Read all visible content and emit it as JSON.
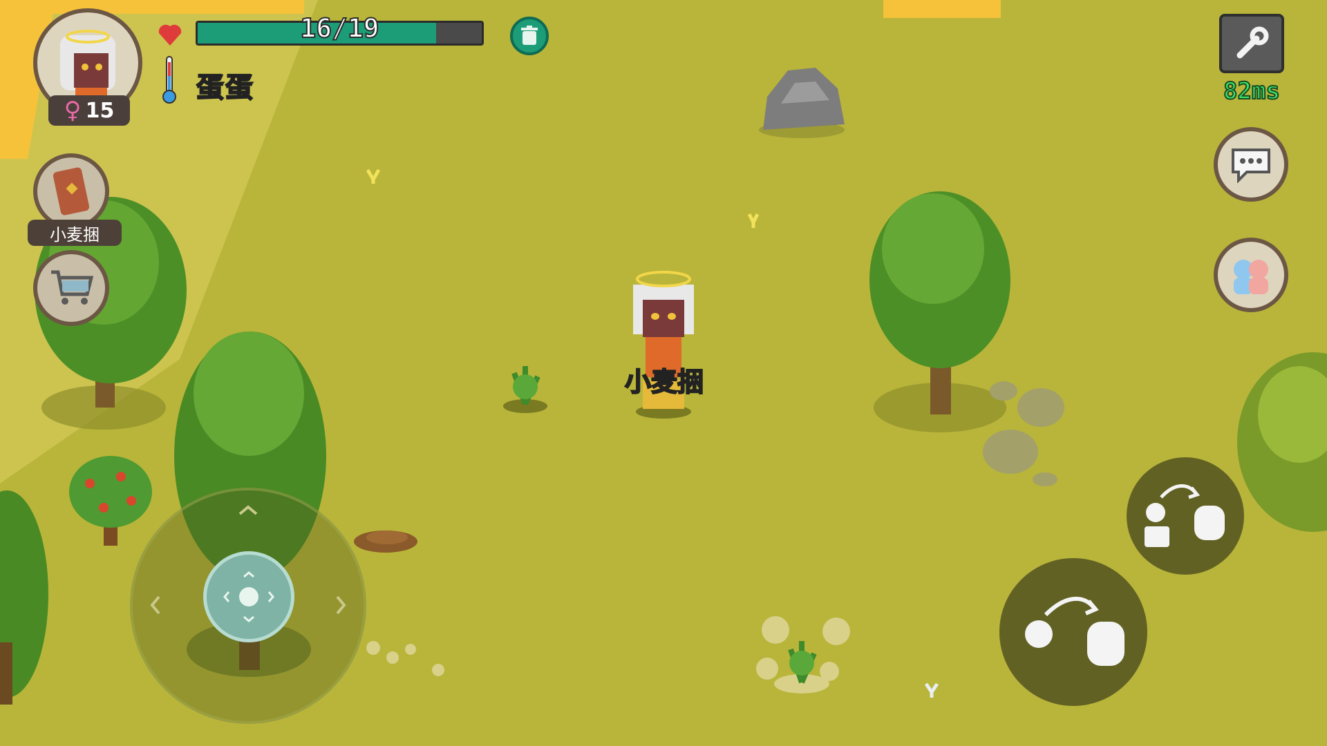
{
  "player": {
    "level": "15",
    "gender_icon": "female-icon",
    "name": "蛋蛋",
    "hp_text": "16/19",
    "hp_fraction": 0.84
  },
  "quick_slot": {
    "label": "小麦捆",
    "icon": "wheat-bundle-icon"
  },
  "shop": {
    "icon": "shopping-cart-icon"
  },
  "top_right": {
    "settings_icon": "wrench-icon",
    "ping": "82ms"
  },
  "side_buttons": {
    "chat_icon": "chat-bubble-icon",
    "friends_icon": "friends-icon"
  },
  "character": {
    "held_item_label": "小麦捆"
  },
  "colors": {
    "grass": "#b8b53a",
    "hp_fill": "#1d9c78",
    "ping_green": "#39e06a",
    "heart": "#e03b3b"
  }
}
